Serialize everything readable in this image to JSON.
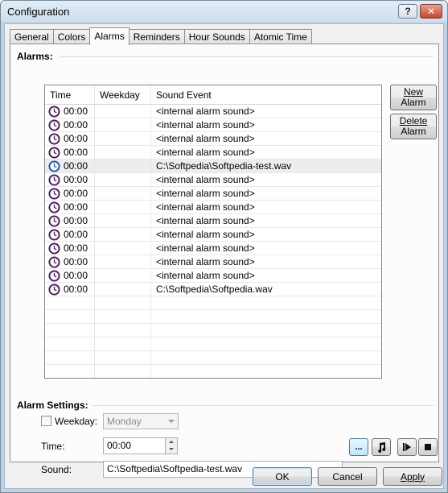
{
  "window": {
    "title": "Configuration",
    "help_label": "?",
    "close_label": "✕"
  },
  "tabs": [
    {
      "label": "General",
      "active": false
    },
    {
      "label": "Colors",
      "active": false
    },
    {
      "label": "Alarms",
      "active": true
    },
    {
      "label": "Reminders",
      "active": false
    },
    {
      "label": "Hour Sounds",
      "active": false
    },
    {
      "label": "Atomic Time",
      "active": false
    }
  ],
  "alarms": {
    "group_label": "Alarms:",
    "columns": [
      "Time",
      "Weekday",
      "Sound Event"
    ],
    "rows": [
      {
        "time": "00:00",
        "weekday": "",
        "sound": "<internal alarm sound>",
        "selected": false
      },
      {
        "time": "00:00",
        "weekday": "",
        "sound": "<internal alarm sound>",
        "selected": false
      },
      {
        "time": "00:00",
        "weekday": "",
        "sound": "<internal alarm sound>",
        "selected": false
      },
      {
        "time": "00:00",
        "weekday": "",
        "sound": "<internal alarm sound>",
        "selected": false
      },
      {
        "time": "00:00",
        "weekday": "",
        "sound": "C:\\Softpedia\\Softpedia-test.wav",
        "selected": true
      },
      {
        "time": "00:00",
        "weekday": "",
        "sound": "<internal alarm sound>",
        "selected": false
      },
      {
        "time": "00:00",
        "weekday": "",
        "sound": "<internal alarm sound>",
        "selected": false
      },
      {
        "time": "00:00",
        "weekday": "",
        "sound": "<internal alarm sound>",
        "selected": false
      },
      {
        "time": "00:00",
        "weekday": "",
        "sound": "<internal alarm sound>",
        "selected": false
      },
      {
        "time": "00:00",
        "weekday": "",
        "sound": "<internal alarm sound>",
        "selected": false
      },
      {
        "time": "00:00",
        "weekday": "",
        "sound": "<internal alarm sound>",
        "selected": false
      },
      {
        "time": "00:00",
        "weekday": "",
        "sound": "<internal alarm sound>",
        "selected": false
      },
      {
        "time": "00:00",
        "weekday": "",
        "sound": "<internal alarm sound>",
        "selected": false
      },
      {
        "time": "00:00",
        "weekday": "",
        "sound": "C:\\Softpedia\\Softpedia.wav",
        "selected": false
      }
    ],
    "empty_rows": 6,
    "new_alarm_line1": "New",
    "new_alarm_line2": "Alarm",
    "delete_alarm_line1": "Delete",
    "delete_alarm_line2": "Alarm"
  },
  "settings": {
    "group_label": "Alarm Settings:",
    "weekday_label": "Weekday:",
    "weekday_checked": false,
    "weekday_value": "Monday",
    "time_label": "Time:",
    "time_value": "00:00",
    "sound_label": "Sound:",
    "sound_value": "C:\\Softpedia\\Softpedia-test.wav",
    "browse_label": "...",
    "music_icon": "music-note-icon",
    "play_icon": "play-icon",
    "stop_icon": "stop-icon"
  },
  "footer": {
    "ok_label": "OK",
    "cancel_label": "Cancel",
    "apply_label": "Apply"
  },
  "colors": {
    "clock_ring": "#4a1a5a",
    "selected_clock": "#1f4fb5"
  }
}
